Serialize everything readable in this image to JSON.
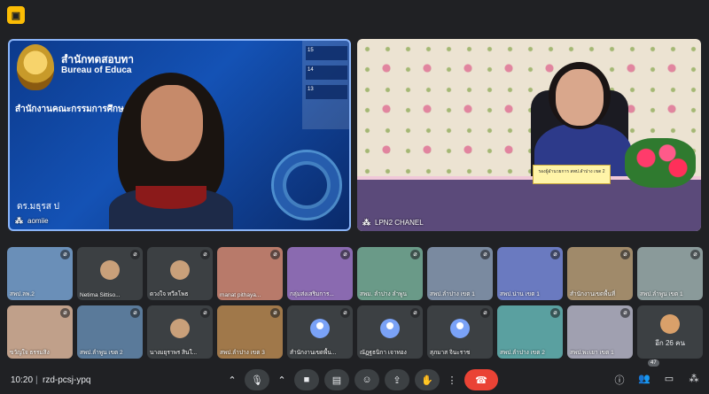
{
  "app": {
    "icon": "meet-app-icon"
  },
  "main_tiles": [
    {
      "name": "aomiie",
      "overlay": {
        "title_line1": "สำนักทดสอบทา",
        "title_line2": "Bureau of Educa",
        "title_line3": "สำนักงานคณะกรรมการศึกษา",
        "presenter_text": "ดร.มธุรส ป",
        "side_numbers": [
          "15",
          "14",
          "13"
        ]
      }
    },
    {
      "name": "LPN2 CHANEL",
      "nameplate": "รองผู้อำนวยการ สพป.ลำปาง เขต 2"
    }
  ],
  "grid_tiles": [
    {
      "label": "สพป.ลพ.2",
      "muted": true
    },
    {
      "label": "Netima Sittiso...",
      "muted": true
    },
    {
      "label": "ดวงใจ ทวีลโพธ",
      "muted": true
    },
    {
      "label": "manat pithaya...",
      "muted": true
    },
    {
      "label": "กลุ่มส่งเสริมการ...",
      "muted": true
    },
    {
      "label": "สพม. ลำปาง ลำพูน",
      "muted": true
    },
    {
      "label": "สพป.ลำปาง เขต 1",
      "muted": true
    },
    {
      "label": "สพป.น่าน เขต 1",
      "muted": true
    },
    {
      "label": "สำนักงานเขตพื้นที่",
      "muted": true
    },
    {
      "label": "สพป.ลำพูน เขต 1",
      "muted": true
    },
    {
      "label": "ขวัญใจ ธรรมสิง",
      "muted": true
    },
    {
      "label": "สพป.ลำพูน เขต 2",
      "muted": true
    },
    {
      "label": "นางมยุราพร สินใ...",
      "muted": true
    },
    {
      "label": "สพป.ลำปาง เขต 3",
      "muted": true
    },
    {
      "label": "สำนักงานเขตพื้น...",
      "muted": true
    },
    {
      "label": "ณัฏฐธนิกา เจาทอง",
      "muted": true
    },
    {
      "label": "สุภมาส จินะราช",
      "muted": true
    },
    {
      "label": "สพป.ลำปาง เขต 2",
      "muted": true
    },
    {
      "label": "สพป.พะเยา เขต 1",
      "muted": true
    }
  ],
  "more": {
    "text": "อีก 26 คน"
  },
  "bottom_bar": {
    "time": "10:20",
    "separator": "|",
    "meeting_code": "rzd-pcsj-ypq",
    "participants_badge": "47"
  },
  "colors": {
    "accent": "#8ab4f8",
    "end_call": "#ea4335",
    "background": "#202124",
    "tile": "#3c4043"
  }
}
